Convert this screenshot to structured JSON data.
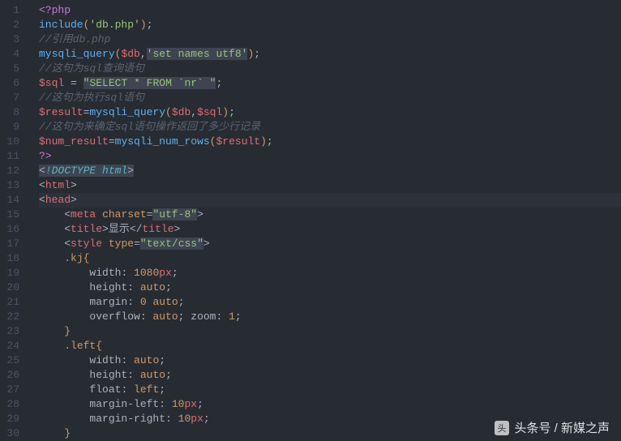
{
  "lineNumbers": [
    "1",
    "2",
    "3",
    "4",
    "5",
    "6",
    "7",
    "8",
    "9",
    "10",
    "11",
    "12",
    "13",
    "14",
    "15",
    "16",
    "17",
    "18",
    "19",
    "20",
    "21",
    "22",
    "23",
    "24",
    "25",
    "26",
    "27",
    "28",
    "29",
    "30"
  ],
  "code": {
    "l1": {
      "open": "<?php"
    },
    "l2": {
      "fn": "include",
      "p1": "(",
      "str": "'db.php'",
      "p2": ")",
      "semi": ";"
    },
    "l3": {
      "comment": "//引用db.php"
    },
    "l4": {
      "fn": "mysqli_query",
      "p1": "(",
      "var": "$db",
      "comma": ",",
      "str": "'set names utf8'",
      "p2": ")",
      "semi": ";"
    },
    "l5": {
      "comment": "//这句为sql查询语句"
    },
    "l6": {
      "var": "$sql",
      "sp": " ",
      "eq": "=",
      "sp2": " ",
      "str": "\"SELECT * FROM `nr` \"",
      "semi": ";"
    },
    "l7": {
      "comment": "//这句为执行sql语句"
    },
    "l8": {
      "var": "$result",
      "eq": "=",
      "fn": "mysqli_query",
      "p1": "(",
      "v1": "$db",
      "comma": ",",
      "v2": "$sql",
      "p2": ")",
      "semi": ";"
    },
    "l9": {
      "comment": "//这句为来确定sql语句操作返回了多少行记录"
    },
    "l10": {
      "var": "$num_result",
      "eq": "=",
      "fn": "mysqli_num_rows",
      "p1": "(",
      "v1": "$result",
      "p2": ")",
      "semi": ";"
    },
    "l11": {
      "close": "?>"
    },
    "l12": {
      "lt": "<",
      "doctype": "!DOCTYPE html",
      "gt": ">"
    },
    "l13": {
      "lt": "<",
      "tag": "html",
      "gt": ">"
    },
    "l14": {
      "lt": "<",
      "tag": "head",
      "gt": ">"
    },
    "l15": {
      "indent": "    ",
      "lt": "<",
      "tag": "meta",
      "sp": " ",
      "attr": "charset",
      "eq": "=",
      "val": "\"utf-8\"",
      "gt": ">"
    },
    "l16": {
      "indent": "    ",
      "lt": "<",
      "tag": "title",
      "gt": ">",
      "text": "显示",
      "lt2": "</",
      "tag2": "title",
      "gt2": ">"
    },
    "l17": {
      "indent": "    ",
      "lt": "<",
      "tag": "style",
      "sp": " ",
      "attr": "type",
      "eq": "=",
      "val": "\"text/css\"",
      "gt": ">"
    },
    "l18": {
      "indent": "    ",
      "sel": ".kj",
      "brace": "{"
    },
    "l19": {
      "indent": "        ",
      "prop": "width",
      "colon": ": ",
      "val": "1080",
      "unit": "px",
      "semi": ";"
    },
    "l20": {
      "indent": "        ",
      "prop": "height",
      "colon": ": ",
      "val": "auto",
      "semi": ";"
    },
    "l21": {
      "indent": "        ",
      "prop": "margin",
      "colon": ": ",
      "val": "0",
      "sp": " ",
      "val2": "auto",
      "semi": ";"
    },
    "l22": {
      "indent": "        ",
      "prop": "overflow",
      "colon": ": ",
      "val": "auto",
      "semi": "; ",
      "prop2": "zoom",
      "colon2": ": ",
      "val2": "1",
      "semi2": ";"
    },
    "l23": {
      "indent": "    ",
      "brace": "}"
    },
    "l24": {
      "indent": "    ",
      "sel": ".left",
      "brace": "{"
    },
    "l25": {
      "indent": "        ",
      "prop": "width",
      "colon": ": ",
      "val": "auto",
      "semi": ";"
    },
    "l26": {
      "indent": "        ",
      "prop": "height",
      "colon": ": ",
      "val": "auto",
      "semi": ";"
    },
    "l27": {
      "indent": "        ",
      "prop": "float",
      "colon": ": ",
      "val": "left",
      "semi": ";"
    },
    "l28": {
      "indent": "        ",
      "prop": "margin-left",
      "colon": ": ",
      "val": "10",
      "unit": "px",
      "semi": ";"
    },
    "l29": {
      "indent": "        ",
      "prop": "margin-right",
      "colon": ": ",
      "val": "10",
      "unit": "px",
      "semi": ";"
    },
    "l30": {
      "indent": "    ",
      "brace": "}"
    }
  },
  "watermark": {
    "label": "头条号 / 新媒之声"
  }
}
